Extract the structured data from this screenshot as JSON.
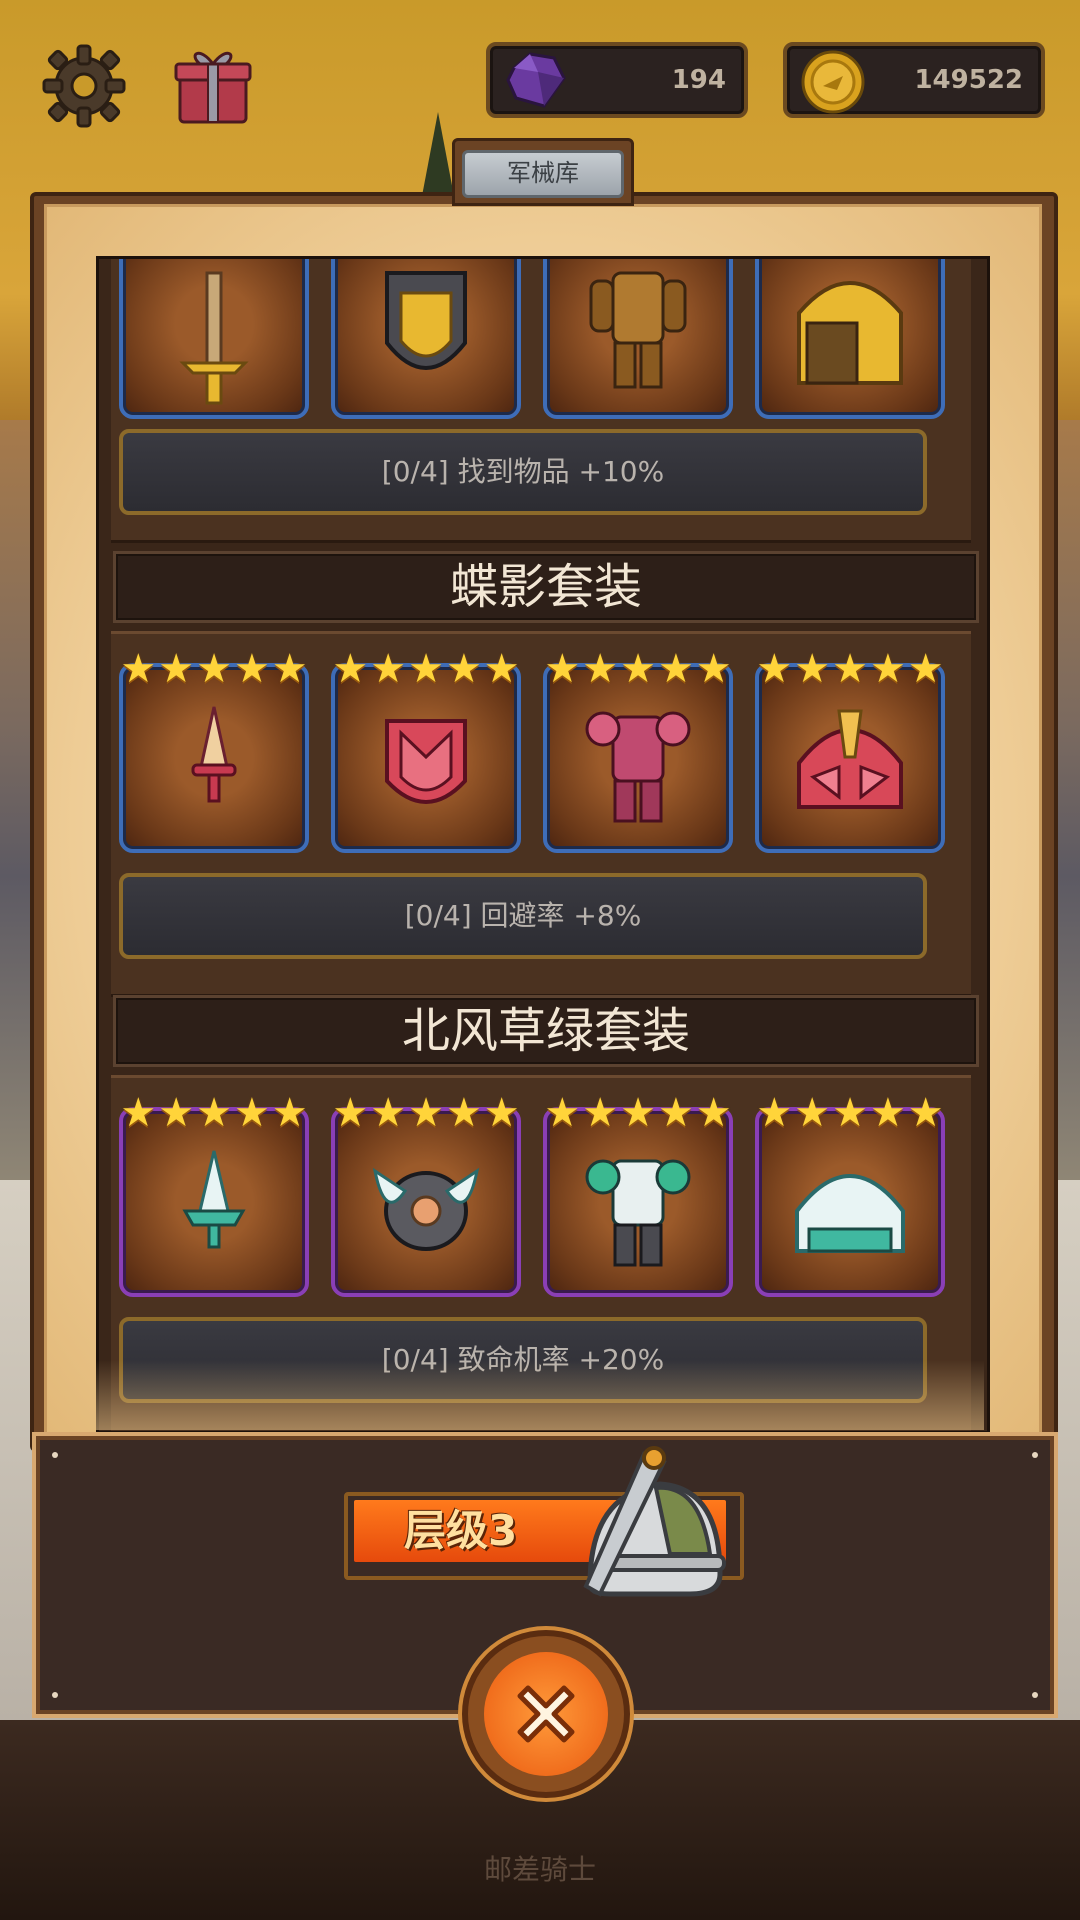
{
  "hud": {
    "gems": "194",
    "coins": "149522",
    "icons": [
      "gear-icon",
      "gift-icon",
      "gem-icon",
      "coin-icon"
    ]
  },
  "panel": {
    "title": "军械库"
  },
  "sets": [
    {
      "name": "",
      "rarity": "blue",
      "stars": 0,
      "items": [
        "sword-icon",
        "shield-icon",
        "armor-icon",
        "helmet-icon"
      ],
      "bonus": "[0/4] 找到物品 +10%"
    },
    {
      "name": "蝶影套装",
      "rarity": "blue",
      "stars": 5,
      "items": [
        "dagger-icon",
        "shield-icon",
        "armor-icon",
        "helmet-icon"
      ],
      "bonus": "[0/4] 回避率 +8%"
    },
    {
      "name": "北风草绿套装",
      "rarity": "purple",
      "stars": 5,
      "items": [
        "dagger-icon",
        "shield-icon",
        "armor-icon",
        "helmet-icon"
      ],
      "bonus": "[0/4] 致命机率 +20%"
    }
  ],
  "bottom": {
    "level_label": "层级3",
    "close_icon": "close-icon"
  },
  "footer": {
    "text": "邮差骑士"
  },
  "colors": {
    "blue_frame": "#3e6db8",
    "purple_frame": "#8a3fb6",
    "star": "#ffd43a",
    "level_fill": "#ea5a10"
  }
}
